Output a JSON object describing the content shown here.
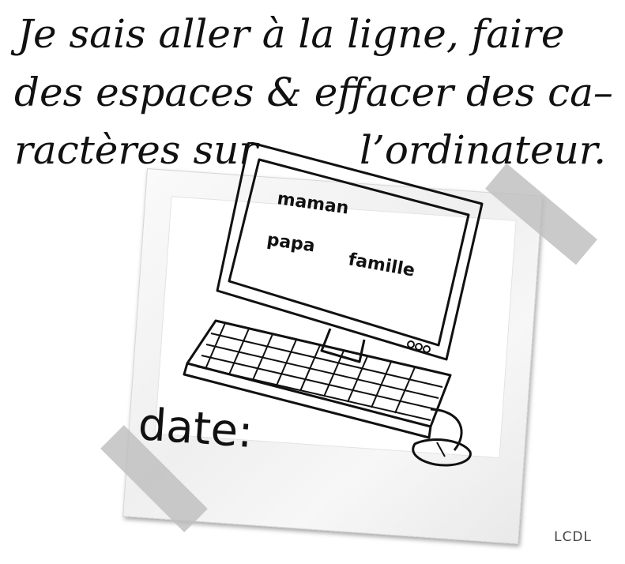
{
  "title": {
    "line1": "Je sais aller à la ligne, faire",
    "line2": "des espaces & effacer des ca–",
    "line3a": "ractères sur",
    "line3b": "l’ordinateur."
  },
  "screen_words": {
    "word1": "maman",
    "word2": "papa",
    "word3": "famille"
  },
  "date_label": "date:",
  "footer": "LCDL"
}
